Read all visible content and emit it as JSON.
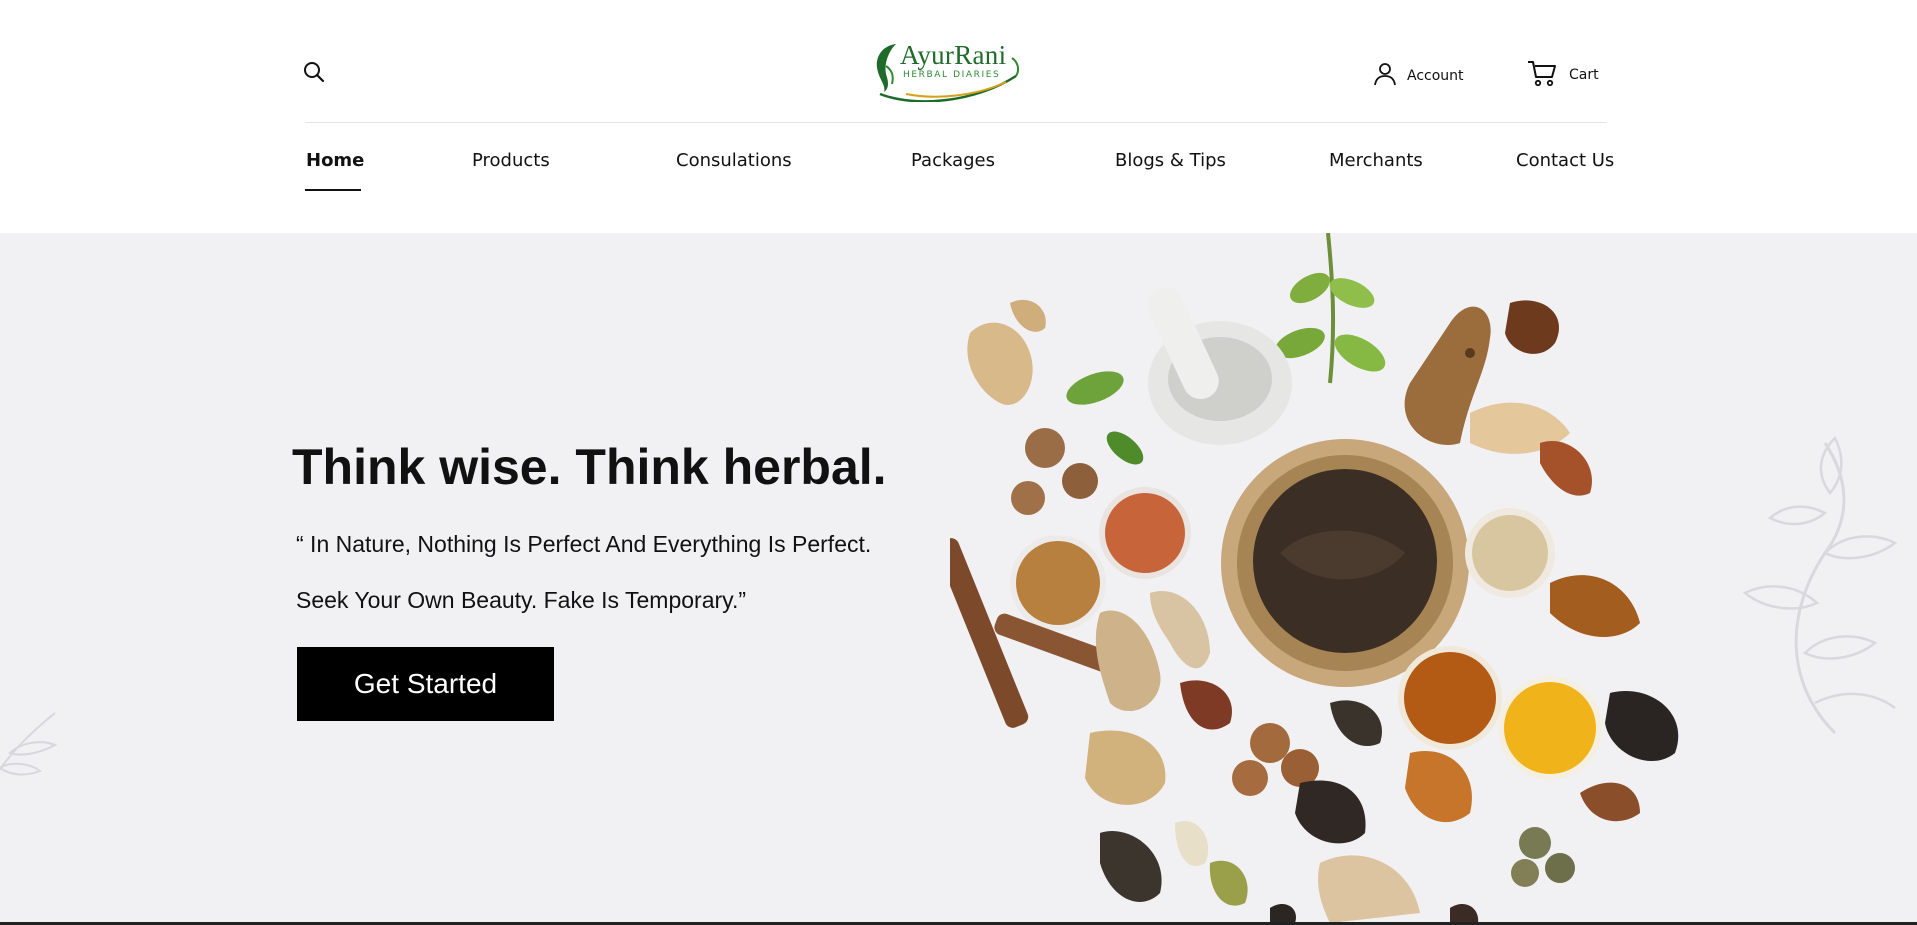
{
  "header": {
    "logo": {
      "name": "AyurRani",
      "tagline": "HERBAL DIARIES"
    },
    "account_label": "Account",
    "cart_label": "Cart"
  },
  "nav": {
    "items": [
      {
        "label": "Home",
        "active": true
      },
      {
        "label": "Products"
      },
      {
        "label": "Consulations"
      },
      {
        "label": "Packages"
      },
      {
        "label": "Blogs & Tips"
      },
      {
        "label": "Merchants"
      },
      {
        "label": "Contact Us"
      }
    ]
  },
  "hero": {
    "headline": "Think wise. Think herbal.",
    "quote_line1": "“ In Nature, Nothing Is Perfect And Everything Is Perfect.",
    "quote_line2": "Seek Your Own Beauty. Fake Is Temporary.”",
    "cta_label": "Get Started",
    "background_color": "#f1f1f3"
  },
  "icons": {
    "search": "search-icon",
    "account": "user-icon",
    "cart": "cart-icon"
  },
  "colors": {
    "brand_green": "#1f6b2a",
    "button_bg": "#000000",
    "button_text": "#ffffff"
  }
}
